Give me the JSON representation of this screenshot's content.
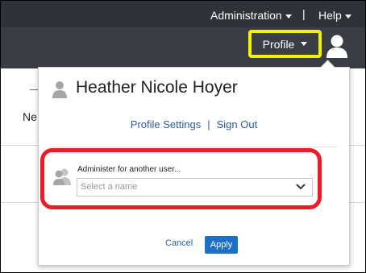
{
  "topnav": {
    "administration_label": "Administration",
    "separator": "|",
    "help_label": "Help"
  },
  "profile": {
    "button_label": "Profile"
  },
  "background": {
    "partial_text": "Ne"
  },
  "dropdown": {
    "user_name": "Heather Nicole Hoyer",
    "profile_settings_label": "Profile Settings",
    "separator": "|",
    "sign_out_label": "Sign Out",
    "administer_label": "Administer for another user...",
    "select_placeholder": "Select a name",
    "cancel_label": "Cancel",
    "apply_label": "Apply"
  },
  "colors": {
    "topbar": "#3a3d44",
    "highlight_yellow": "#f3f300",
    "highlight_red": "#e81d26",
    "link_blue": "#2b5c9e",
    "apply_blue": "#1c70c7"
  }
}
